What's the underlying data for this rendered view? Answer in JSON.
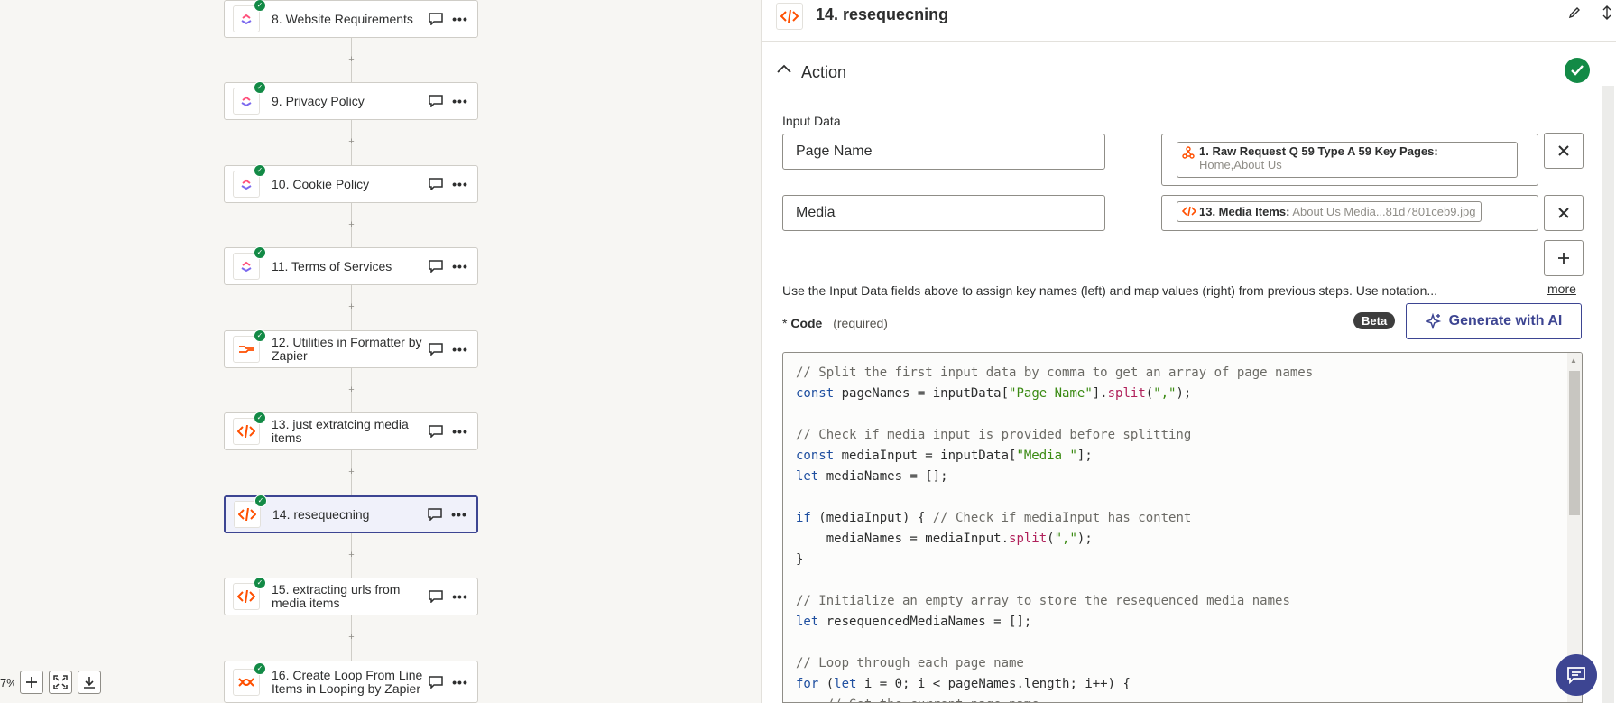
{
  "canvas": {
    "zoom_label": "7%",
    "steps": [
      {
        "title": "8. Website Requirements",
        "icon": "clickup-icon"
      },
      {
        "title": "9. Privacy Policy",
        "icon": "clickup-icon"
      },
      {
        "title": "10. Cookie Policy",
        "icon": "clickup-icon"
      },
      {
        "title": "11. Terms of Services",
        "icon": "clickup-icon"
      },
      {
        "title": "12. Utilities in Formatter by Zapier",
        "icon": "formatter-icon"
      },
      {
        "title": "13. just extratcing media items",
        "icon": "code-icon"
      },
      {
        "title": "14. resequecning",
        "icon": "code-icon"
      },
      {
        "title": "15. extracting urls from media items",
        "icon": "code-icon"
      },
      {
        "title": "16. Create Loop From Line Items in Looping by Zapier",
        "icon": "looping-icon"
      }
    ]
  },
  "panel": {
    "title": "14. resequecning",
    "section_title": "Action",
    "input_data_label": "Input Data",
    "rows": [
      {
        "key": "Page Name",
        "pill_bold": "1. Raw Request Q 59 Type A 59 Key Pages:",
        "pill_value": "Home,About Us"
      },
      {
        "key": "Media",
        "pill_bold": "13. Media Items:",
        "pill_value": "About Us Media...81d7801ceb9.jpg"
      }
    ],
    "hint": "Use the Input Data fields above to assign key names (left) and map values (right) from previous steps. Use notation...",
    "more_link": "more",
    "code_label_star": "*",
    "code_label": "Code",
    "code_required": "(required)",
    "beta_badge": "Beta",
    "generate_button": "Generate with AI",
    "code_lines": [
      "// Split the first input data by comma to get an array of page names",
      "const pageNames = inputData[\"Page Name\"].split(\",\");",
      "",
      "// Check if media input is provided before splitting",
      "const mediaInput = inputData[\"Media \"];",
      "let mediaNames = [];",
      "",
      "if (mediaInput) { // Check if mediaInput has content",
      "    mediaNames = mediaInput.split(\",\");",
      "}",
      "",
      "// Initialize an empty array to store the resequenced media names",
      "let resequencedMediaNames = [];",
      "",
      "// Loop through each page name",
      "for (let i = 0; i < pageNames.length; i++) {",
      "    // Get the current page name"
    ]
  },
  "colors": {
    "accent": "#3d4592",
    "success": "#138a46",
    "code_orange": "#ff4f00"
  }
}
